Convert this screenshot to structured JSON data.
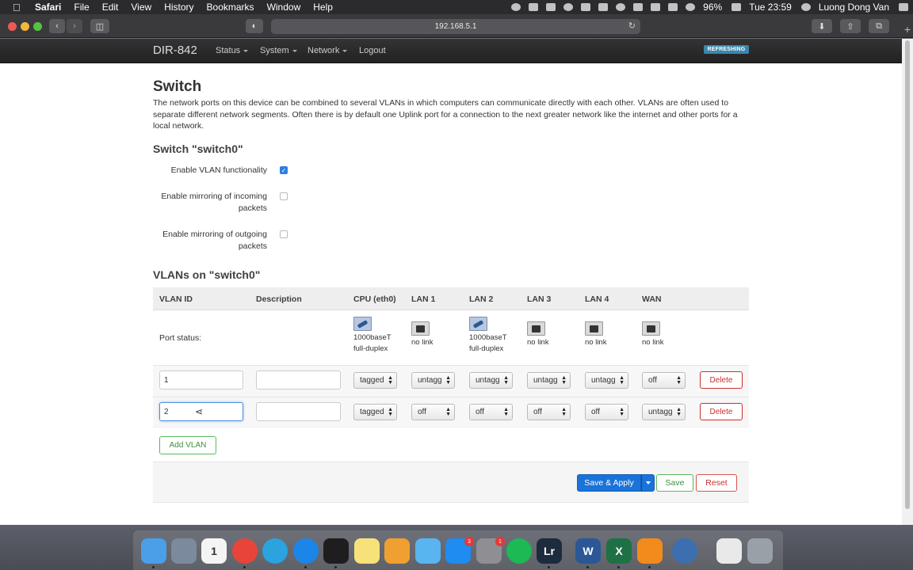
{
  "menubar": {
    "app": "Safari",
    "items": [
      "File",
      "Edit",
      "View",
      "History",
      "Bookmarks",
      "Window",
      "Help"
    ],
    "battery": "96%",
    "clock": "Tue 23:59",
    "user": "Luong Dong Van"
  },
  "browser": {
    "url": "192.168.5.1"
  },
  "nav": {
    "brand": "DIR-842",
    "items": [
      "Status",
      "System",
      "Network",
      "Logout"
    ],
    "badge": "REFRESHING"
  },
  "page": {
    "title": "Switch",
    "description": "The network ports on this device can be combined to several VLANs in which computers can communicate directly with each other. VLANs are often used to separate different network segments. Often there is by default one Uplink port for a connection to the next greater network like the internet and other ports for a local network.",
    "switch_heading": "Switch \"switch0\"",
    "options": [
      {
        "label": "Enable VLAN functionality",
        "checked": true
      },
      {
        "label": "Enable mirroring of incoming packets",
        "checked": false
      },
      {
        "label": "Enable mirroring of outgoing packets",
        "checked": false
      }
    ],
    "vlans_heading": "VLANs on \"switch0\""
  },
  "table": {
    "headers": [
      "VLAN ID",
      "Description",
      "CPU (eth0)",
      "LAN 1",
      "LAN 2",
      "LAN 3",
      "LAN 4",
      "WAN"
    ],
    "port_status_label": "Port status:",
    "port_status": [
      {
        "line1": "1000baseT",
        "line2": "full-duplex",
        "up": true
      },
      {
        "line1": "no link",
        "line2": "",
        "up": false
      },
      {
        "line1": "1000baseT",
        "line2": "full-duplex",
        "up": true
      },
      {
        "line1": "no link",
        "line2": "",
        "up": false
      },
      {
        "line1": "no link",
        "line2": "",
        "up": false
      },
      {
        "line1": "no link",
        "line2": "",
        "up": false
      }
    ],
    "rows": [
      {
        "vlan_id": "1",
        "description": "",
        "ports": [
          "tagged",
          "untagg",
          "untagg",
          "untagg",
          "untagg",
          "off"
        ],
        "delete": "Delete"
      },
      {
        "vlan_id": "2",
        "description": "",
        "ports": [
          "tagged",
          "off",
          "off",
          "off",
          "off",
          "untagg"
        ],
        "delete": "Delete"
      }
    ],
    "add_label": "Add VLAN"
  },
  "footer": {
    "save_apply": "Save & Apply",
    "save": "Save",
    "reset": "Reset"
  },
  "dock": {
    "apps": [
      {
        "name": "Finder",
        "icon": "finder-icon",
        "color": "#4a9fe8"
      },
      {
        "name": "Launchpad",
        "icon": "rocket-icon",
        "color": "#7b8a9c"
      },
      {
        "name": "Calendar",
        "icon": "calendar-icon",
        "color": "#f4f4f4",
        "text": "1"
      },
      {
        "name": "Chrome",
        "icon": "chrome-icon",
        "color": "#e8443a"
      },
      {
        "name": "Telegram",
        "icon": "telegram-icon",
        "color": "#2aa3df"
      },
      {
        "name": "Safari",
        "icon": "safari-icon",
        "color": "#1b86e8"
      },
      {
        "name": "Terminal",
        "icon": "terminal-icon",
        "color": "#1e1e1e"
      },
      {
        "name": "Notes",
        "icon": "notes-icon",
        "color": "#f7e27a"
      },
      {
        "name": "Photos",
        "icon": "photos-icon",
        "color": "#f0a030"
      },
      {
        "name": "Messages",
        "icon": "messages-icon",
        "color": "#5ab4f0"
      },
      {
        "name": "App Store",
        "icon": "app-store-icon",
        "color": "#1e8cf0",
        "badge": "3"
      },
      {
        "name": "System Preferences",
        "icon": "gear-icon",
        "color": "#8e8e93",
        "badge": "1"
      },
      {
        "name": "Spotify",
        "icon": "spotify-icon",
        "color": "#1db954"
      },
      {
        "name": "Lightroom",
        "icon": "lightroom-icon",
        "color": "#1c2b3e",
        "text": "Lr"
      },
      {
        "name": "Word",
        "icon": "word-icon",
        "color": "#2b5797",
        "text": "W"
      },
      {
        "name": "Excel",
        "icon": "excel-icon",
        "color": "#1e7145",
        "text": "X"
      },
      {
        "name": "VLC",
        "icon": "vlc-icon",
        "color": "#f38b1c"
      },
      {
        "name": "Screen Recorder",
        "icon": "recorder-icon",
        "color": "#3c6fb0"
      },
      {
        "name": "Document",
        "icon": "document-icon",
        "color": "#e9e9e9"
      },
      {
        "name": "Trash",
        "icon": "trash-icon",
        "color": "#9aa0a8"
      }
    ]
  }
}
